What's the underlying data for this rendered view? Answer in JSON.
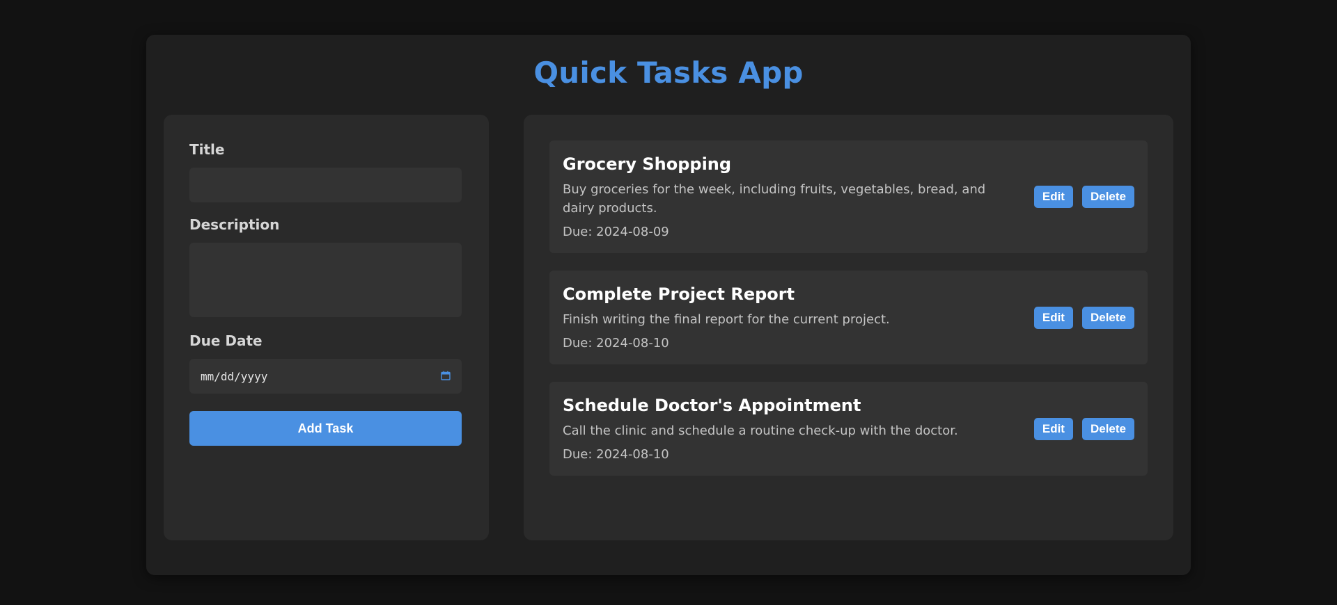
{
  "app": {
    "title": "Quick Tasks App"
  },
  "form": {
    "title_label": "Title",
    "title_value": "",
    "description_label": "Description",
    "description_value": "",
    "due_date_label": "Due Date",
    "due_date_placeholder": "mm/dd/yyyy",
    "add_button_label": "Add Task"
  },
  "tasks": [
    {
      "title": "Grocery Shopping",
      "description": "Buy groceries for the week, including fruits, vegetables, bread, and dairy products.",
      "due": "Due: 2024-08-09",
      "edit_label": "Edit",
      "delete_label": "Delete"
    },
    {
      "title": "Complete Project Report",
      "description": "Finish writing the final report for the current project.",
      "due": "Due: 2024-08-10",
      "edit_label": "Edit",
      "delete_label": "Delete"
    },
    {
      "title": "Schedule Doctor's Appointment",
      "description": "Call the clinic and schedule a routine check-up with the doctor.",
      "due": "Due: 2024-08-10",
      "edit_label": "Edit",
      "delete_label": "Delete"
    }
  ],
  "icons": {
    "date_picker": "calendar-icon"
  },
  "colors": {
    "accent": "#4a90e2",
    "page_background": "#121212",
    "container_background": "#1f1f1f",
    "panel_background": "#2a2a2a",
    "card_background": "#333333"
  }
}
